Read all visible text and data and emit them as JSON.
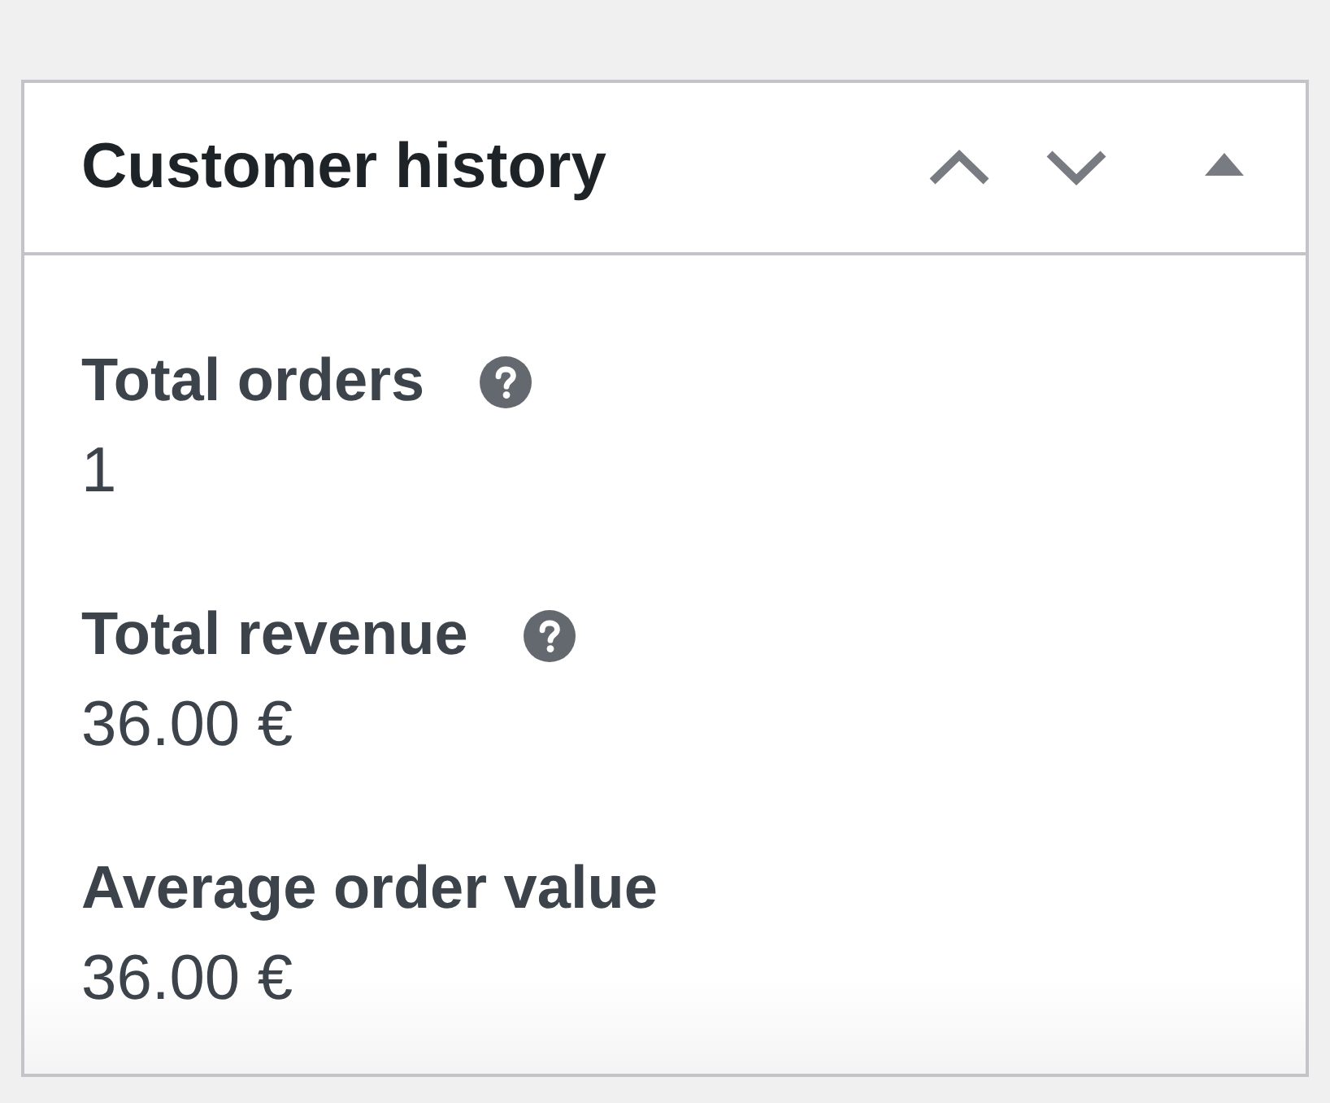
{
  "panel": {
    "title": "Customer history",
    "expanded": true
  },
  "stats": [
    {
      "label": "Total orders",
      "help": true,
      "value": "1"
    },
    {
      "label": "Total revenue",
      "help": true,
      "value": "36.00 €"
    },
    {
      "label": "Average order value",
      "help": false,
      "value": "36.00 €"
    }
  ]
}
